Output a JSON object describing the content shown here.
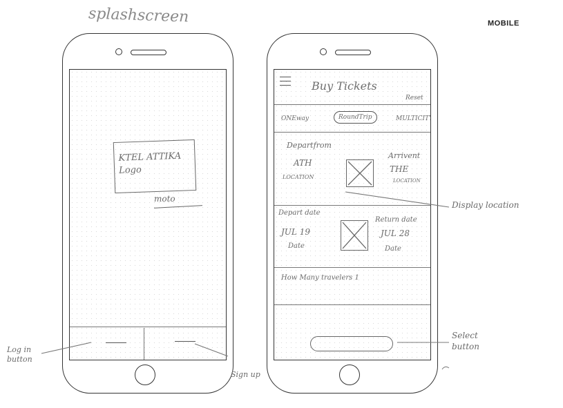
{
  "header": {
    "splash_title": "splashscreen",
    "platform_label": "MOBILE"
  },
  "splash": {
    "logo_text": "KTEL ATTIKA Logo",
    "moto": "moto"
  },
  "booking": {
    "title": "Buy Tickets",
    "reset": "Reset",
    "trip_types": [
      "ONEway",
      "RoundTrip",
      "MULTICITY"
    ],
    "depart_from_label": "Departfrom",
    "depart_from_code": "ATH",
    "depart_from_location": "LOCATION",
    "arrive_label": "Arrivent",
    "arrive_code": "THE",
    "arrive_location": "LOCATION",
    "depart_date_label": "Depart date",
    "depart_date_value": "JUL 19",
    "depart_date_hint": "Date",
    "return_date_label": "Return date",
    "return_date_value": "JUL 28",
    "return_date_hint": "Date",
    "travelers_text": "How Many travelers 1"
  },
  "annotations": {
    "login": "Log in button",
    "signup": "Sign up",
    "display_location": "Display location",
    "select_button": "Select button"
  }
}
